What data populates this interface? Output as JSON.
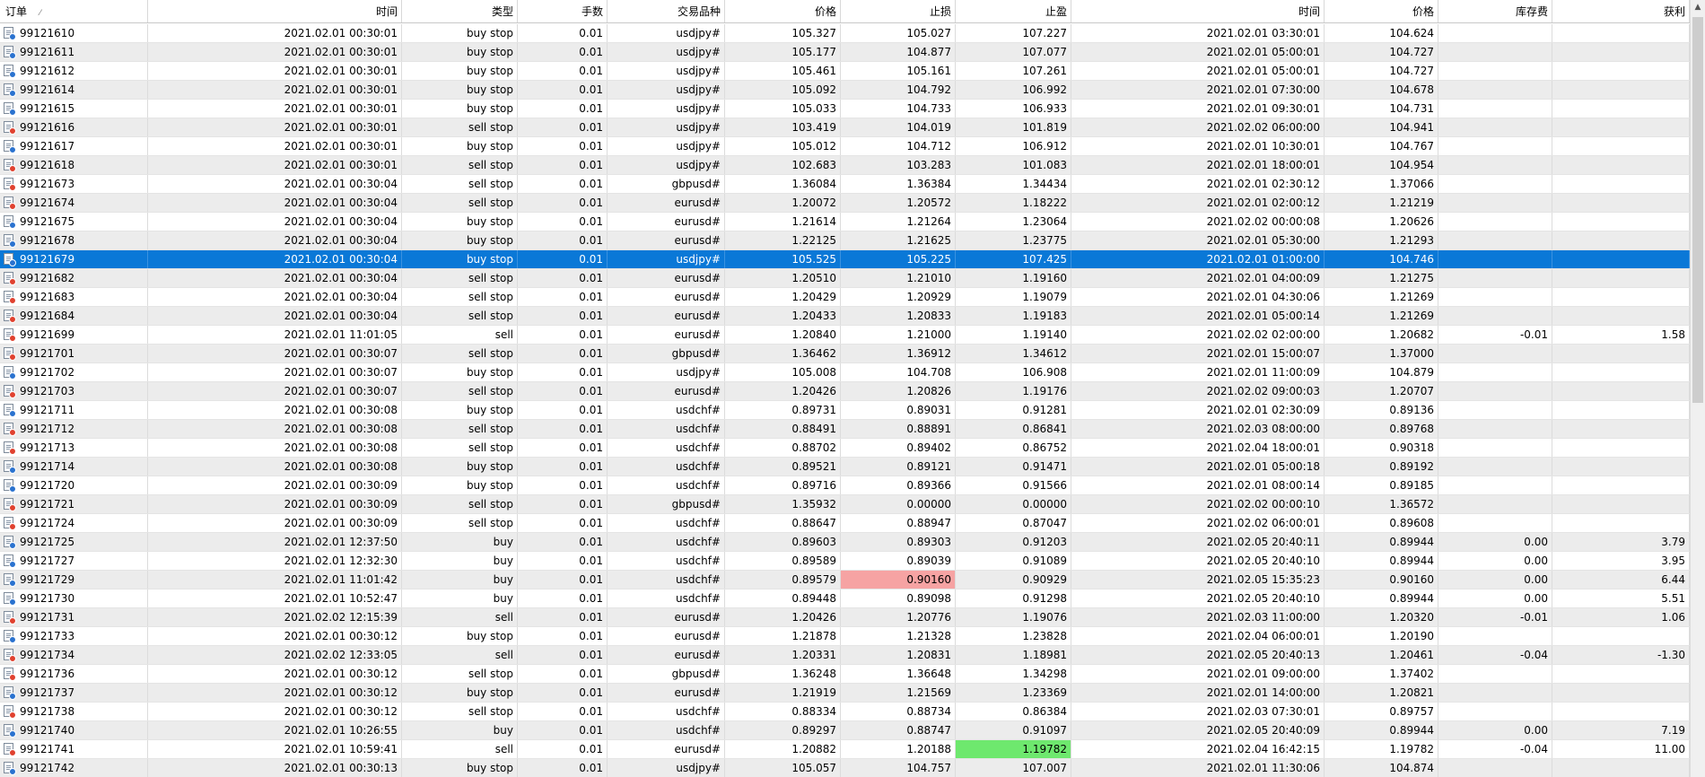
{
  "columns": [
    "订单",
    "时间",
    "类型",
    "手数",
    "交易品种",
    "价格",
    "止损",
    "止盈",
    "时间",
    "价格",
    "库存费",
    "获利"
  ],
  "sort_indicator": "⁄",
  "rows": [
    {
      "order": "99121610",
      "open_time": "2021.02.01 00:30:01",
      "type": "buy stop",
      "side": "buy",
      "volume": "0.01",
      "symbol": "usdjpy#",
      "price": "105.327",
      "sl": "105.027",
      "tp": "107.227",
      "close_time": "2021.02.01 03:30:01",
      "close_price": "104.624",
      "swap": "",
      "profit": ""
    },
    {
      "order": "99121611",
      "open_time": "2021.02.01 00:30:01",
      "type": "buy stop",
      "side": "buy",
      "volume": "0.01",
      "symbol": "usdjpy#",
      "price": "105.177",
      "sl": "104.877",
      "tp": "107.077",
      "close_time": "2021.02.01 05:00:01",
      "close_price": "104.727",
      "swap": "",
      "profit": ""
    },
    {
      "order": "99121612",
      "open_time": "2021.02.01 00:30:01",
      "type": "buy stop",
      "side": "buy",
      "volume": "0.01",
      "symbol": "usdjpy#",
      "price": "105.461",
      "sl": "105.161",
      "tp": "107.261",
      "close_time": "2021.02.01 05:00:01",
      "close_price": "104.727",
      "swap": "",
      "profit": ""
    },
    {
      "order": "99121614",
      "open_time": "2021.02.01 00:30:01",
      "type": "buy stop",
      "side": "buy",
      "volume": "0.01",
      "symbol": "usdjpy#",
      "price": "105.092",
      "sl": "104.792",
      "tp": "106.992",
      "close_time": "2021.02.01 07:30:00",
      "close_price": "104.678",
      "swap": "",
      "profit": ""
    },
    {
      "order": "99121615",
      "open_time": "2021.02.01 00:30:01",
      "type": "buy stop",
      "side": "buy",
      "volume": "0.01",
      "symbol": "usdjpy#",
      "price": "105.033",
      "sl": "104.733",
      "tp": "106.933",
      "close_time": "2021.02.01 09:30:01",
      "close_price": "104.731",
      "swap": "",
      "profit": ""
    },
    {
      "order": "99121616",
      "open_time": "2021.02.01 00:30:01",
      "type": "sell stop",
      "side": "sell",
      "volume": "0.01",
      "symbol": "usdjpy#",
      "price": "103.419",
      "sl": "104.019",
      "tp": "101.819",
      "close_time": "2021.02.02 06:00:00",
      "close_price": "104.941",
      "swap": "",
      "profit": ""
    },
    {
      "order": "99121617",
      "open_time": "2021.02.01 00:30:01",
      "type": "buy stop",
      "side": "buy",
      "volume": "0.01",
      "symbol": "usdjpy#",
      "price": "105.012",
      "sl": "104.712",
      "tp": "106.912",
      "close_time": "2021.02.01 10:30:01",
      "close_price": "104.767",
      "swap": "",
      "profit": ""
    },
    {
      "order": "99121618",
      "open_time": "2021.02.01 00:30:01",
      "type": "sell stop",
      "side": "sell",
      "volume": "0.01",
      "symbol": "usdjpy#",
      "price": "102.683",
      "sl": "103.283",
      "tp": "101.083",
      "close_time": "2021.02.01 18:00:01",
      "close_price": "104.954",
      "swap": "",
      "profit": ""
    },
    {
      "order": "99121673",
      "open_time": "2021.02.01 00:30:04",
      "type": "sell stop",
      "side": "sell",
      "volume": "0.01",
      "symbol": "gbpusd#",
      "price": "1.36084",
      "sl": "1.36384",
      "tp": "1.34434",
      "close_time": "2021.02.01 02:30:12",
      "close_price": "1.37066",
      "swap": "",
      "profit": ""
    },
    {
      "order": "99121674",
      "open_time": "2021.02.01 00:30:04",
      "type": "sell stop",
      "side": "sell",
      "volume": "0.01",
      "symbol": "eurusd#",
      "price": "1.20072",
      "sl": "1.20572",
      "tp": "1.18222",
      "close_time": "2021.02.01 02:00:12",
      "close_price": "1.21219",
      "swap": "",
      "profit": ""
    },
    {
      "order": "99121675",
      "open_time": "2021.02.01 00:30:04",
      "type": "buy stop",
      "side": "buy",
      "volume": "0.01",
      "symbol": "eurusd#",
      "price": "1.21614",
      "sl": "1.21264",
      "tp": "1.23064",
      "close_time": "2021.02.02 00:00:08",
      "close_price": "1.20626",
      "swap": "",
      "profit": ""
    },
    {
      "order": "99121678",
      "open_time": "2021.02.01 00:30:04",
      "type": "buy stop",
      "side": "buy",
      "volume": "0.01",
      "symbol": "eurusd#",
      "price": "1.22125",
      "sl": "1.21625",
      "tp": "1.23775",
      "close_time": "2021.02.01 05:30:00",
      "close_price": "1.21293",
      "swap": "",
      "profit": ""
    },
    {
      "order": "99121679",
      "open_time": "2021.02.01 00:30:04",
      "type": "buy stop",
      "side": "buy",
      "volume": "0.01",
      "symbol": "usdjpy#",
      "price": "105.525",
      "sl": "105.225",
      "tp": "107.425",
      "close_time": "2021.02.01 01:00:00",
      "close_price": "104.746",
      "swap": "",
      "profit": "",
      "selected": true
    },
    {
      "order": "99121682",
      "open_time": "2021.02.01 00:30:04",
      "type": "sell stop",
      "side": "sell",
      "volume": "0.01",
      "symbol": "eurusd#",
      "price": "1.20510",
      "sl": "1.21010",
      "tp": "1.19160",
      "close_time": "2021.02.01 04:00:09",
      "close_price": "1.21275",
      "swap": "",
      "profit": ""
    },
    {
      "order": "99121683",
      "open_time": "2021.02.01 00:30:04",
      "type": "sell stop",
      "side": "sell",
      "volume": "0.01",
      "symbol": "eurusd#",
      "price": "1.20429",
      "sl": "1.20929",
      "tp": "1.19079",
      "close_time": "2021.02.01 04:30:06",
      "close_price": "1.21269",
      "swap": "",
      "profit": ""
    },
    {
      "order": "99121684",
      "open_time": "2021.02.01 00:30:04",
      "type": "sell stop",
      "side": "sell",
      "volume": "0.01",
      "symbol": "eurusd#",
      "price": "1.20433",
      "sl": "1.20833",
      "tp": "1.19183",
      "close_time": "2021.02.01 05:00:14",
      "close_price": "1.21269",
      "swap": "",
      "profit": ""
    },
    {
      "order": "99121699",
      "open_time": "2021.02.01 11:01:05",
      "type": "sell",
      "side": "sell",
      "volume": "0.01",
      "symbol": "eurusd#",
      "price": "1.20840",
      "sl": "1.21000",
      "tp": "1.19140",
      "close_time": "2021.02.02 02:00:00",
      "close_price": "1.20682",
      "swap": "-0.01",
      "profit": "1.58"
    },
    {
      "order": "99121701",
      "open_time": "2021.02.01 00:30:07",
      "type": "sell stop",
      "side": "sell",
      "volume": "0.01",
      "symbol": "gbpusd#",
      "price": "1.36462",
      "sl": "1.36912",
      "tp": "1.34612",
      "close_time": "2021.02.01 15:00:07",
      "close_price": "1.37000",
      "swap": "",
      "profit": ""
    },
    {
      "order": "99121702",
      "open_time": "2021.02.01 00:30:07",
      "type": "buy stop",
      "side": "buy",
      "volume": "0.01",
      "symbol": "usdjpy#",
      "price": "105.008",
      "sl": "104.708",
      "tp": "106.908",
      "close_time": "2021.02.01 11:00:09",
      "close_price": "104.879",
      "swap": "",
      "profit": ""
    },
    {
      "order": "99121703",
      "open_time": "2021.02.01 00:30:07",
      "type": "sell stop",
      "side": "sell",
      "volume": "0.01",
      "symbol": "eurusd#",
      "price": "1.20426",
      "sl": "1.20826",
      "tp": "1.19176",
      "close_time": "2021.02.02 09:00:03",
      "close_price": "1.20707",
      "swap": "",
      "profit": ""
    },
    {
      "order": "99121711",
      "open_time": "2021.02.01 00:30:08",
      "type": "buy stop",
      "side": "buy",
      "volume": "0.01",
      "symbol": "usdchf#",
      "price": "0.89731",
      "sl": "0.89031",
      "tp": "0.91281",
      "close_time": "2021.02.01 02:30:09",
      "close_price": "0.89136",
      "swap": "",
      "profit": ""
    },
    {
      "order": "99121712",
      "open_time": "2021.02.01 00:30:08",
      "type": "sell stop",
      "side": "sell",
      "volume": "0.01",
      "symbol": "usdchf#",
      "price": "0.88491",
      "sl": "0.88891",
      "tp": "0.86841",
      "close_time": "2021.02.03 08:00:00",
      "close_price": "0.89768",
      "swap": "",
      "profit": ""
    },
    {
      "order": "99121713",
      "open_time": "2021.02.01 00:30:08",
      "type": "sell stop",
      "side": "sell",
      "volume": "0.01",
      "symbol": "usdchf#",
      "price": "0.88702",
      "sl": "0.89402",
      "tp": "0.86752",
      "close_time": "2021.02.04 18:00:01",
      "close_price": "0.90318",
      "swap": "",
      "profit": ""
    },
    {
      "order": "99121714",
      "open_time": "2021.02.01 00:30:08",
      "type": "buy stop",
      "side": "buy",
      "volume": "0.01",
      "symbol": "usdchf#",
      "price": "0.89521",
      "sl": "0.89121",
      "tp": "0.91471",
      "close_time": "2021.02.01 05:00:18",
      "close_price": "0.89192",
      "swap": "",
      "profit": ""
    },
    {
      "order": "99121720",
      "open_time": "2021.02.01 00:30:09",
      "type": "buy stop",
      "side": "buy",
      "volume": "0.01",
      "symbol": "usdchf#",
      "price": "0.89716",
      "sl": "0.89366",
      "tp": "0.91566",
      "close_time": "2021.02.01 08:00:14",
      "close_price": "0.89185",
      "swap": "",
      "profit": ""
    },
    {
      "order": "99121721",
      "open_time": "2021.02.01 00:30:09",
      "type": "sell stop",
      "side": "sell",
      "volume": "0.01",
      "symbol": "gbpusd#",
      "price": "1.35932",
      "sl": "0.00000",
      "tp": "0.00000",
      "close_time": "2021.02.02 00:00:10",
      "close_price": "1.36572",
      "swap": "",
      "profit": ""
    },
    {
      "order": "99121724",
      "open_time": "2021.02.01 00:30:09",
      "type": "sell stop",
      "side": "sell",
      "volume": "0.01",
      "symbol": "usdchf#",
      "price": "0.88647",
      "sl": "0.88947",
      "tp": "0.87047",
      "close_time": "2021.02.02 06:00:01",
      "close_price": "0.89608",
      "swap": "",
      "profit": ""
    },
    {
      "order": "99121725",
      "open_time": "2021.02.01 12:37:50",
      "type": "buy",
      "side": "buy",
      "volume": "0.01",
      "symbol": "usdchf#",
      "price": "0.89603",
      "sl": "0.89303",
      "tp": "0.91203",
      "close_time": "2021.02.05 20:40:11",
      "close_price": "0.89944",
      "swap": "0.00",
      "profit": "3.79"
    },
    {
      "order": "99121727",
      "open_time": "2021.02.01 12:32:30",
      "type": "buy",
      "side": "buy",
      "volume": "0.01",
      "symbol": "usdchf#",
      "price": "0.89589",
      "sl": "0.89039",
      "tp": "0.91089",
      "close_time": "2021.02.05 20:40:10",
      "close_price": "0.89944",
      "swap": "0.00",
      "profit": "3.95"
    },
    {
      "order": "99121729",
      "open_time": "2021.02.01 11:01:42",
      "type": "buy",
      "side": "buy",
      "volume": "0.01",
      "symbol": "usdchf#",
      "price": "0.89579",
      "sl": "0.90160",
      "tp": "0.90929",
      "close_time": "2021.02.05 15:35:23",
      "close_price": "0.90160",
      "swap": "0.00",
      "profit": "6.44",
      "sl_highlight": "#f6a3a3"
    },
    {
      "order": "99121730",
      "open_time": "2021.02.01 10:52:47",
      "type": "buy",
      "side": "buy",
      "volume": "0.01",
      "symbol": "usdchf#",
      "price": "0.89448",
      "sl": "0.89098",
      "tp": "0.91298",
      "close_time": "2021.02.05 20:40:10",
      "close_price": "0.89944",
      "swap": "0.00",
      "profit": "5.51"
    },
    {
      "order": "99121731",
      "open_time": "2021.02.02 12:15:39",
      "type": "sell",
      "side": "sell",
      "volume": "0.01",
      "symbol": "eurusd#",
      "price": "1.20426",
      "sl": "1.20776",
      "tp": "1.19076",
      "close_time": "2021.02.03 11:00:00",
      "close_price": "1.20320",
      "swap": "-0.01",
      "profit": "1.06"
    },
    {
      "order": "99121733",
      "open_time": "2021.02.01 00:30:12",
      "type": "buy stop",
      "side": "buy",
      "volume": "0.01",
      "symbol": "eurusd#",
      "price": "1.21878",
      "sl": "1.21328",
      "tp": "1.23828",
      "close_time": "2021.02.04 06:00:01",
      "close_price": "1.20190",
      "swap": "",
      "profit": ""
    },
    {
      "order": "99121734",
      "open_time": "2021.02.02 12:33:05",
      "type": "sell",
      "side": "sell",
      "volume": "0.01",
      "symbol": "eurusd#",
      "price": "1.20331",
      "sl": "1.20831",
      "tp": "1.18981",
      "close_time": "2021.02.05 20:40:13",
      "close_price": "1.20461",
      "swap": "-0.04",
      "profit": "-1.30"
    },
    {
      "order": "99121736",
      "open_time": "2021.02.01 00:30:12",
      "type": "sell stop",
      "side": "sell",
      "volume": "0.01",
      "symbol": "gbpusd#",
      "price": "1.36248",
      "sl": "1.36648",
      "tp": "1.34298",
      "close_time": "2021.02.01 09:00:00",
      "close_price": "1.37402",
      "swap": "",
      "profit": ""
    },
    {
      "order": "99121737",
      "open_time": "2021.02.01 00:30:12",
      "type": "buy stop",
      "side": "buy",
      "volume": "0.01",
      "symbol": "eurusd#",
      "price": "1.21919",
      "sl": "1.21569",
      "tp": "1.23369",
      "close_time": "2021.02.01 14:00:00",
      "close_price": "1.20821",
      "swap": "",
      "profit": ""
    },
    {
      "order": "99121738",
      "open_time": "2021.02.01 00:30:12",
      "type": "sell stop",
      "side": "sell",
      "volume": "0.01",
      "symbol": "usdchf#",
      "price": "0.88334",
      "sl": "0.88734",
      "tp": "0.86384",
      "close_time": "2021.02.03 07:30:01",
      "close_price": "0.89757",
      "swap": "",
      "profit": ""
    },
    {
      "order": "99121740",
      "open_time": "2021.02.01 10:26:55",
      "type": "buy",
      "side": "buy",
      "volume": "0.01",
      "symbol": "usdchf#",
      "price": "0.89297",
      "sl": "0.88747",
      "tp": "0.91097",
      "close_time": "2021.02.05 20:40:09",
      "close_price": "0.89944",
      "swap": "0.00",
      "profit": "7.19"
    },
    {
      "order": "99121741",
      "open_time": "2021.02.01 10:59:41",
      "type": "sell",
      "side": "sell",
      "volume": "0.01",
      "symbol": "eurusd#",
      "price": "1.20882",
      "sl": "1.20188",
      "tp": "1.19782",
      "close_time": "2021.02.04 16:42:15",
      "close_price": "1.19782",
      "swap": "-0.04",
      "profit": "11.00",
      "tp_highlight": "#6ee86e"
    },
    {
      "order": "99121742",
      "open_time": "2021.02.01 00:30:13",
      "type": "buy stop",
      "side": "buy",
      "volume": "0.01",
      "symbol": "usdjpy#",
      "price": "105.057",
      "sl": "104.757",
      "tp": "107.007",
      "close_time": "2021.02.01 11:30:06",
      "close_price": "104.874",
      "swap": "",
      "profit": ""
    }
  ],
  "scrollbar": {
    "up_icon": "chevron-up-icon"
  },
  "colors": {
    "selected_row": "#0a78d7",
    "alt_row": "#ececec",
    "sl_hit": "#f6a3a3",
    "tp_hit": "#6ee86e",
    "buy_dot": "#2a72cf",
    "sell_dot": "#e0412f"
  }
}
